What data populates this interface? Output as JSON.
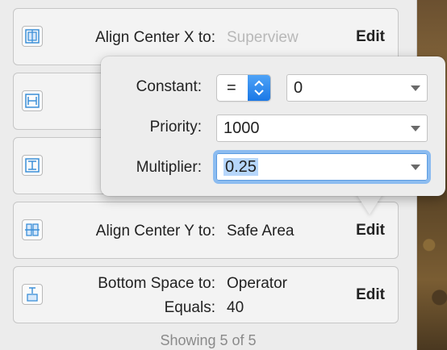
{
  "constraints": [
    {
      "label": "Align Center X to:",
      "value": "Superview",
      "value_muted": true,
      "edit": "Edit",
      "icon": "align-center-x-icon"
    },
    {
      "label": "",
      "value": "",
      "edit": "",
      "icon": "horizontal-spacing-icon"
    },
    {
      "label": "",
      "value": "",
      "edit": "",
      "icon": "vertical-spacing-icon"
    },
    {
      "label": "Align Center Y to:",
      "value": "Safe Area",
      "edit": "Edit",
      "icon": "align-center-y-icon"
    },
    {
      "label": "Bottom Space to:",
      "value": "Operator",
      "label2": "Equals:",
      "value2": "40",
      "edit": "Edit",
      "icon": "bottom-space-icon"
    }
  ],
  "footer": "Showing 5 of 5",
  "popover": {
    "constant_label": "Constant:",
    "relation": "=",
    "constant_value": "0",
    "priority_label": "Priority:",
    "priority_value": "1000",
    "multiplier_label": "Multiplier:",
    "multiplier_value": "0.25"
  },
  "colors": {
    "icon_blue": "#3b8fd8",
    "focus_ring": "#8cbcf0",
    "selection": "#b6d6fb"
  }
}
